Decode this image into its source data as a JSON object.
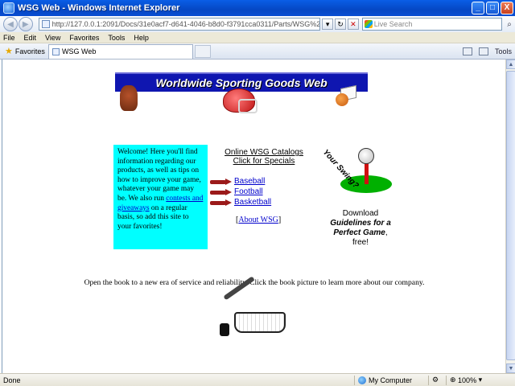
{
  "window": {
    "title": "WSG Web - Windows Internet Explorer",
    "controls": {
      "minimize": "_",
      "maximize": "□",
      "close": "X"
    }
  },
  "address_bar": {
    "url": "http://127.0.0.1:2091/Docs/31e0acf7-d641-4046-b8d0-f3791cca0311/Parts/WSG%20Website/Default.htm",
    "search_placeholder": "Live Search"
  },
  "menu": [
    "File",
    "Edit",
    "View",
    "Favorites",
    "Tools",
    "Help"
  ],
  "favorites_label": "Favorites",
  "tab": {
    "label": "WSG Web"
  },
  "command_bar": {
    "tools_label": "Tools"
  },
  "page": {
    "banner_title": "Worldwide Sporting Goods Web",
    "welcome": {
      "text_before": "Welcome! Here you'll find information regarding our products, as well as tips on how to improve your game, whatever your game may be. We also run ",
      "link": "contests and giveaways",
      "text_after": " on a regular basis, so add this site to your favorites!"
    },
    "catalog": {
      "header_line1": "Online WSG Catalogs",
      "header_line2": "Click for Specials",
      "items": [
        "Baseball",
        "Football",
        "Basketball"
      ],
      "about_link": "About WSG",
      "about_open": "[",
      "about_close": "]"
    },
    "golf": {
      "swing_text": "Your Swing?",
      "download_line1": "Download",
      "download_bold": "Guidelines for a Perfect Game",
      "download_line3": "free!"
    },
    "book_line": "Open the book to a new era of service and reliability. Click the book picture to learn more about our company."
  },
  "status": {
    "text": "Done",
    "zone": "My Computer",
    "zoom": "100%"
  }
}
